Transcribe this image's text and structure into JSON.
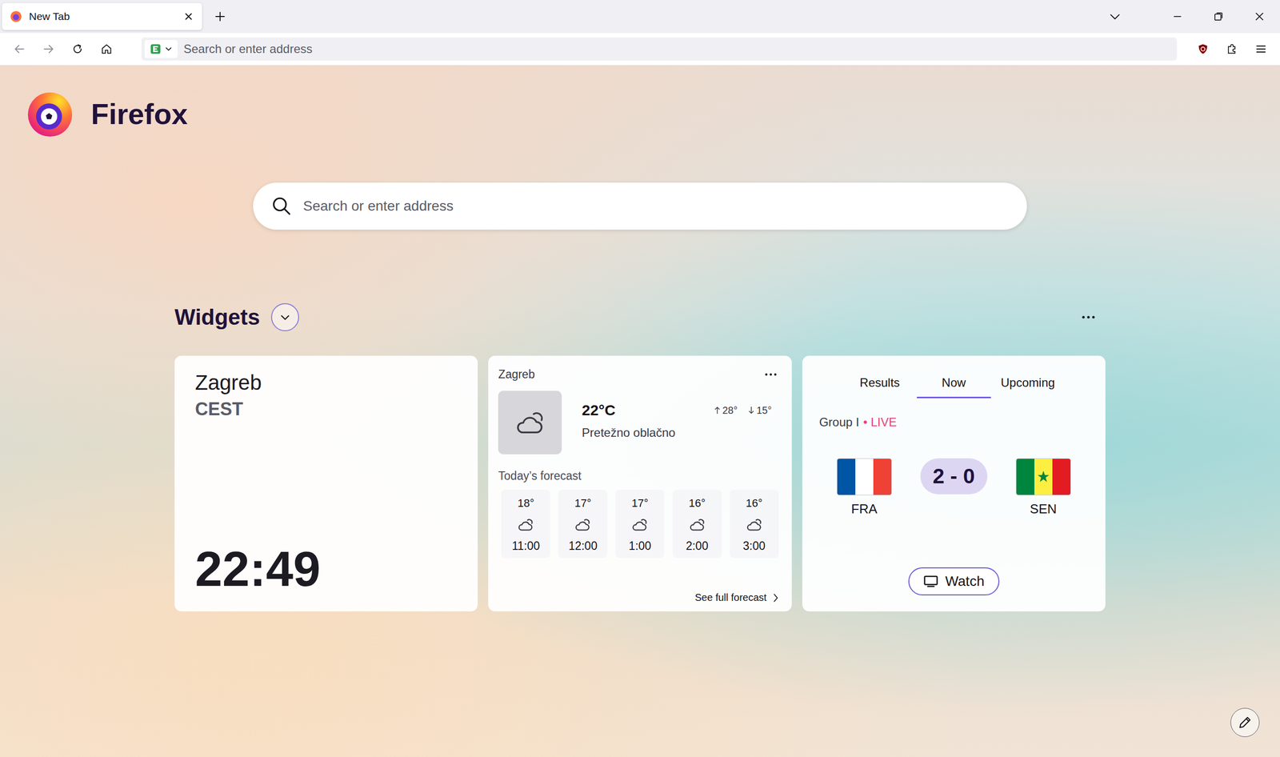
{
  "tabs": [
    {
      "label": "New Tab",
      "selected": true
    }
  ],
  "navigation": {
    "back_disabled": true,
    "forward_disabled": true
  },
  "address_bar": {
    "placeholder": "Search or enter address"
  },
  "brand": {
    "name": "Firefox"
  },
  "search": {
    "placeholder": "Search or enter address"
  },
  "widgets": {
    "title": "Widgets",
    "expanded": true
  },
  "clock": {
    "city": "Zagreb",
    "timezone": "CEST",
    "time": "22:49"
  },
  "weather": {
    "city": "Zagreb",
    "temperature": "22°C",
    "high": "28°",
    "low": "15°",
    "condition": "Pretežno oblačno",
    "forecast_title": "Today’s forecast",
    "hours": [
      {
        "temp": "18°",
        "time": "11:00"
      },
      {
        "temp": "17°",
        "time": "12:00"
      },
      {
        "temp": "17°",
        "time": "1:00"
      },
      {
        "temp": "16°",
        "time": "2:00"
      },
      {
        "temp": "16°",
        "time": "3:00"
      }
    ],
    "link": "See full forecast"
  },
  "sports": {
    "tabs": [
      {
        "label": "Results",
        "selected": false
      },
      {
        "label": "Now",
        "selected": true
      },
      {
        "label": "Upcoming",
        "selected": false
      }
    ],
    "group": "Group I",
    "separator": "•",
    "status": "LIVE",
    "score": "2 - 0",
    "teams": [
      {
        "name": "FRA",
        "stripes": [
          "#0055a4",
          "#ffffff",
          "#ef4135"
        ],
        "star": false
      },
      {
        "name": "SEN",
        "stripes": [
          "#00853f",
          "#fdef42",
          "#e31b23"
        ],
        "star": true
      }
    ],
    "watch": "Watch"
  }
}
